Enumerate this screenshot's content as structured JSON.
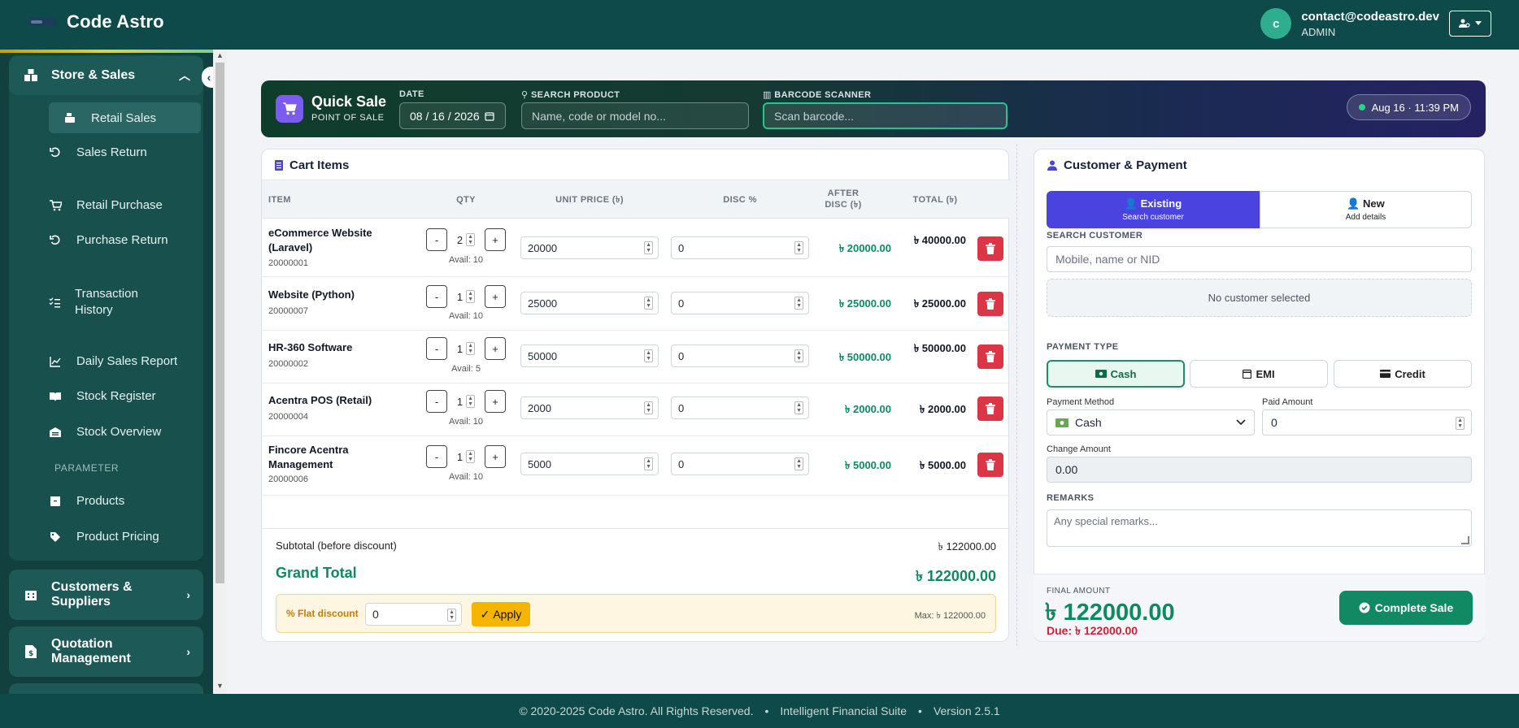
{
  "app": {
    "brand": "Code Astro"
  },
  "user": {
    "initial": "c",
    "email": "contact@codeastro.dev",
    "role": "ADMIN"
  },
  "sidebar": {
    "group_store": "Store & Sales",
    "items": [
      {
        "label": "Retail Sales",
        "icon": "cash-register-icon"
      },
      {
        "label": "Sales Return",
        "icon": "undo-icon"
      },
      {
        "label": "Retail Purchase",
        "icon": "cart-icon"
      },
      {
        "label": "Purchase Return",
        "icon": "undo-icon"
      },
      {
        "label": "Transaction History",
        "icon": "list-check-icon"
      },
      {
        "label": "Daily Sales Report",
        "icon": "chart-line-icon"
      },
      {
        "label": "Stock Register",
        "icon": "book-icon"
      },
      {
        "label": "Stock Overview",
        "icon": "warehouse-icon"
      },
      {
        "label": "Products",
        "icon": "box-icon"
      },
      {
        "label": "Product Pricing",
        "icon": "tag-icon"
      }
    ],
    "section_parameter": "PARAMETER",
    "group_customers": "Customers & Suppliers",
    "group_quotation": "Quotation Management"
  },
  "header": {
    "title": "Quick Sale",
    "subtitle": "POINT OF SALE",
    "date_label": "DATE",
    "date_value": "08 / 16 / 2026",
    "search_label": "SEARCH PRODUCT",
    "search_placeholder": "Name, code or model no...",
    "barcode_label": "BARCODE SCANNER",
    "barcode_placeholder": "Scan barcode...",
    "clock": "Aug 16 · 11:39 PM"
  },
  "cart": {
    "title": "Cart Items",
    "columns": [
      "ITEM",
      "QTY",
      "UNIT PRICE (৳)",
      "DISC %",
      "AFTER DISC (৳)",
      "TOTAL (৳)"
    ],
    "rows": [
      {
        "name": "eCommerce Website (Laravel)",
        "code": "20000001",
        "qty": "2",
        "avail": "Avail: 10",
        "price": "20000",
        "disc": "0",
        "after": "৳ 20000.00",
        "total": "৳ 40000.00"
      },
      {
        "name": "Website (Python)",
        "code": "20000007",
        "qty": "1",
        "avail": "Avail: 10",
        "price": "25000",
        "disc": "0",
        "after": "৳ 25000.00",
        "total": "৳ 25000.00"
      },
      {
        "name": "HR-360 Software",
        "code": "20000002",
        "qty": "1",
        "avail": "Avail: 5",
        "price": "50000",
        "disc": "0",
        "after": "৳ 50000.00",
        "total": "৳ 50000.00"
      },
      {
        "name": "Acentra POS (Retail)",
        "code": "20000004",
        "qty": "1",
        "avail": "Avail: 10",
        "price": "2000",
        "disc": "0",
        "after": "৳ 2000.00",
        "total": "৳ 2000.00"
      },
      {
        "name": "Fincore Acentra Management",
        "code": "20000006",
        "qty": "1",
        "avail": "Avail: 10",
        "price": "5000",
        "disc": "0",
        "after": "৳ 5000.00",
        "total": "৳ 5000.00"
      }
    ],
    "subtotal_label": "Subtotal (before discount)",
    "subtotal_value": "৳ 122000.00",
    "grand_total_label": "Grand Total",
    "grand_total_value": "৳ 122000.00",
    "flat_discount_label": "Flat discount",
    "flat_discount_value": "0",
    "apply_label": "Apply",
    "max_label": "Max: ৳ 122000.00"
  },
  "customer": {
    "title": "Customer & Payment",
    "existing_label": "Existing",
    "existing_sub": "Search customer",
    "new_label": "New",
    "new_sub": "Add details",
    "search_label": "SEARCH CUSTOMER",
    "search_placeholder": "Mobile, name or NID",
    "no_customer": "No customer selected",
    "payment_type_label": "PAYMENT TYPE",
    "payment_types": [
      "Cash",
      "EMI",
      "Credit"
    ],
    "payment_method_label": "Payment Method",
    "payment_method_value": "Cash",
    "paid_amount_label": "Paid Amount",
    "paid_amount_value": "0",
    "change_label": "Change Amount",
    "change_value": "0.00",
    "remarks_label": "REMARKS",
    "remarks_placeholder": "Any special remarks...",
    "final_label": "FINAL AMOUNT",
    "final_value": "৳ 122000.00",
    "due_value": "Due: ৳ 122000.00",
    "complete_label": "Complete Sale"
  },
  "footer": {
    "copyright": "© 2020-2025 Code Astro. All Rights Reserved.",
    "suite": "Intelligent Financial Suite",
    "version": "Version 2.5.1"
  },
  "colors": {
    "topbar": "#0f4a4a",
    "sidebar": "#12403f",
    "accent_green": "#0f8a5f",
    "primary_purple": "#4b43e0",
    "danger": "#dc3545",
    "warning": "#f4b400"
  }
}
